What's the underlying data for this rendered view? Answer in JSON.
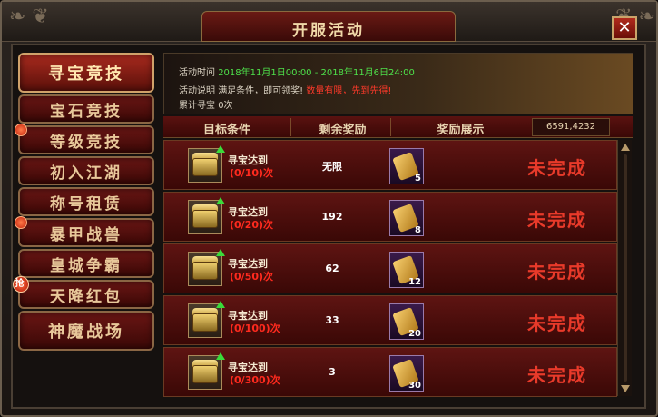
{
  "window": {
    "title": "开服活动",
    "close_label": "✕"
  },
  "sidebar": {
    "items": [
      {
        "label": "寻宝竞技",
        "active": true,
        "badge": ""
      },
      {
        "label": "宝石竞技",
        "active": false,
        "badge": ""
      },
      {
        "label": "等级竞技",
        "active": false,
        "badge": "dot"
      },
      {
        "label": "初入江湖",
        "active": false,
        "badge": ""
      },
      {
        "label": "称号租赁",
        "active": false,
        "badge": ""
      },
      {
        "label": "暴甲战兽",
        "active": false,
        "badge": "dot"
      },
      {
        "label": "皇城争霸",
        "active": false,
        "badge": ""
      },
      {
        "label": "天降红包",
        "active": false,
        "badge": "抢"
      },
      {
        "label": "神魔战场",
        "active": false,
        "badge": ""
      }
    ]
  },
  "info": {
    "time_label": "活动时间",
    "time_value": "2018年11月1日00:00 - 2018年11月6日24:00",
    "desc_label": "活动说明",
    "desc_text": "满足条件，即可领奖!",
    "desc_warning": "数量有限，先到先得!",
    "total_label": "累计寻宝",
    "total_value": "0次"
  },
  "table": {
    "headers": {
      "condition": "目标条件",
      "remaining": "剩余奖励",
      "display": "奖励展示"
    },
    "coords": "6591,4232",
    "rows": [
      {
        "label": "寻宝达到",
        "progress": "(0/10)次",
        "remaining": "无限",
        "reward_count": "5",
        "status": "未完成"
      },
      {
        "label": "寻宝达到",
        "progress": "(0/20)次",
        "remaining": "192",
        "reward_count": "8",
        "status": "未完成"
      },
      {
        "label": "寻宝达到",
        "progress": "(0/50)次",
        "remaining": "62",
        "reward_count": "12",
        "status": "未完成"
      },
      {
        "label": "寻宝达到",
        "progress": "(0/100)次",
        "remaining": "33",
        "reward_count": "20",
        "status": "未完成"
      },
      {
        "label": "寻宝达到",
        "progress": "(0/300)次",
        "remaining": "3",
        "reward_count": "30",
        "status": "未完成"
      }
    ]
  }
}
